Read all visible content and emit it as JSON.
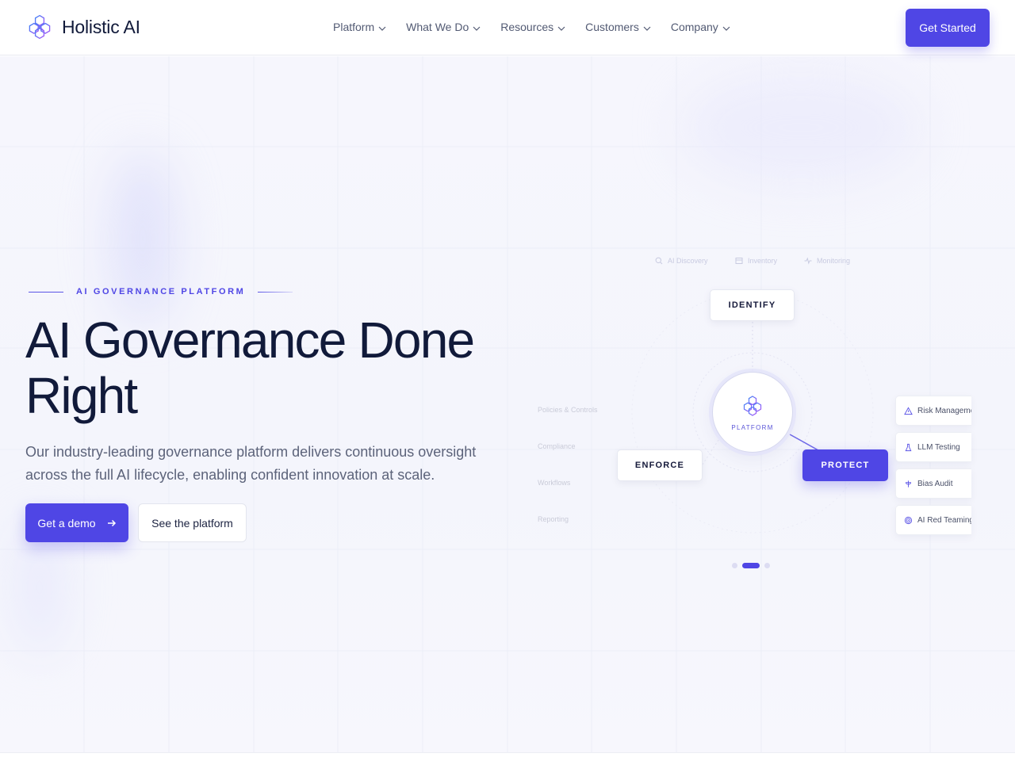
{
  "brand": {
    "name": "Holistic AI",
    "logo_icon": "hexagon-network-icon"
  },
  "nav": {
    "items": [
      {
        "label": "Platform"
      },
      {
        "label": "What We Do"
      },
      {
        "label": "Resources"
      },
      {
        "label": "Customers"
      },
      {
        "label": "Company"
      }
    ],
    "cta": "Get Started"
  },
  "hero": {
    "eyebrow": "AI GOVERNANCE PLATFORM",
    "headline": "AI Governance Done Right",
    "subtext": "Our industry-leading governance platform delivers continuous oversight across the full AI lifecycle, enabling confident innovation at scale.",
    "primary_button": "Get a demo",
    "secondary_button": "See the platform"
  },
  "diagram": {
    "top_tabs": [
      {
        "label": "AI Discovery",
        "icon": "search-icon"
      },
      {
        "label": "Inventory",
        "icon": "table-icon"
      },
      {
        "label": "Monitoring",
        "icon": "activity-icon"
      }
    ],
    "stages": {
      "identify": "IDENTIFY",
      "enforce": "ENFORCE",
      "protect": "PROTECT"
    },
    "active_stage": "protect",
    "center_label": "PLATFORM",
    "enforce_items": [
      "Policies & Controls",
      "Compliance",
      "Workflows",
      "Reporting"
    ],
    "protect_items": [
      {
        "label": "Risk Management",
        "icon": "warning-triangle-icon"
      },
      {
        "label": "LLM Testing",
        "icon": "flask-icon"
      },
      {
        "label": "Bias Audit",
        "icon": "scale-icon"
      },
      {
        "label": "AI Red Teaming",
        "icon": "target-icon"
      }
    ],
    "carousel": {
      "slides": 3,
      "active_index": 1
    }
  },
  "colors": {
    "accent": "#4f46e5",
    "text": "#111a3a",
    "muted": "#5c637a"
  }
}
